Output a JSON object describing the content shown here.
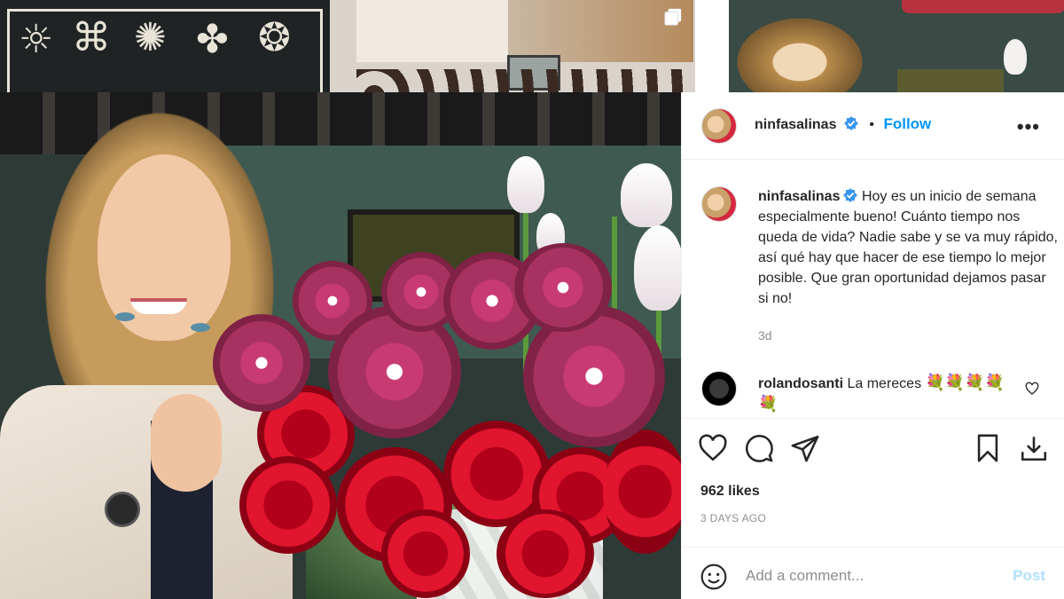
{
  "post": {
    "username": "ninfasalinas",
    "follow_label": "Follow",
    "separator": "•",
    "more_label": "•••",
    "caption": "Hoy es un inicio de semana especialmente bueno! Cuánto tiempo nos queda de vida? Nadie sabe y se va muy rápido, así qué hay que hacer de ese tiempo lo mejor posible. Que gran oportunidad dejamos pasar si no!",
    "caption_time": "3d",
    "likes": "962 likes",
    "date": "3 DAYS AGO"
  },
  "comment": {
    "username": "rolandosanti",
    "text": "La mereces",
    "emojis": "💐💐💐💐💐"
  },
  "add_comment": {
    "placeholder": "Add a comment...",
    "post_label": "Post"
  },
  "colors": {
    "accent": "#0095f6",
    "verified": "#3897f0",
    "post_disabled": "#b2dffc"
  },
  "icons": [
    "verified-badge-icon",
    "more-options-icon",
    "like-heart-icon",
    "comment-icon",
    "share-icon",
    "save-bookmark-icon",
    "download-icon",
    "emoji-icon",
    "multiple-posts-icon"
  ]
}
